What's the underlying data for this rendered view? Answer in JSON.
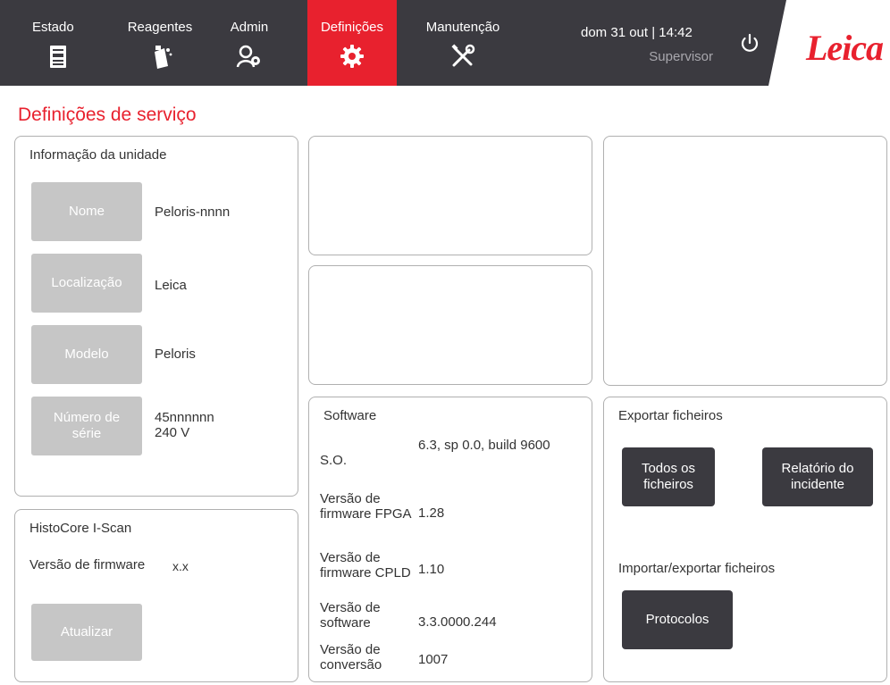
{
  "nav": {
    "tabs": [
      {
        "label": "Estado",
        "icon": "instrument-icon"
      },
      {
        "label": "Reagentes",
        "icon": "reagent-bottle-icon"
      },
      {
        "label": "Admin",
        "icon": "admin-user-gear-icon"
      },
      {
        "label": "Definições",
        "icon": "gear-icon",
        "active": true
      },
      {
        "label": "Manutenção",
        "icon": "tools-icon"
      }
    ],
    "datetime": "dom 31 out | 14:42",
    "user": "Supervisor",
    "logo": "Leica"
  },
  "colors": {
    "accent": "#e8212e",
    "topbar": "#3b3a40",
    "button_gray": "#c6c6c6",
    "button_dark": "#3b3a40"
  },
  "page": {
    "title": "Definições de serviço"
  },
  "unit_info": {
    "title": "Informação da unidade",
    "rows": [
      {
        "button": "Nome",
        "value": "Peloris-nnnn"
      },
      {
        "button": "Localização",
        "value": "Leica"
      },
      {
        "button": "Modelo",
        "value": "Peloris"
      },
      {
        "button": "Número de série",
        "value": "45nnnnnn",
        "value2": "240 V"
      }
    ]
  },
  "iscan": {
    "title": "HistoCore I-Scan",
    "firmware_label": "Versão de firmware",
    "firmware_value": "x.x",
    "update_button": "Atualizar"
  },
  "software": {
    "title": "Software",
    "rows": [
      {
        "label": "S.O.",
        "value": "6.3, sp 0.0, build 9600"
      },
      {
        "label": "Versão de firmware FPGA",
        "value": "1.28"
      },
      {
        "label": "Versão de firmware CPLD",
        "value": "1.10"
      },
      {
        "label": "Versão de software",
        "value": "3.3.0000.244"
      },
      {
        "label": "Versão de conversão",
        "value": "1007"
      }
    ]
  },
  "export": {
    "title": "Exportar ficheiros",
    "all_files_button": "Todos os ficheiros",
    "incident_report_button": "Relatório do incidente",
    "import_export_title": "Importar/exportar ficheiros",
    "protocols_button": "Protocolos"
  }
}
